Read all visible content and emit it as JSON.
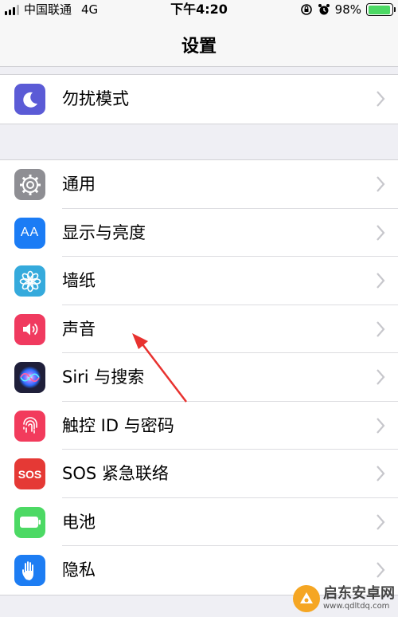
{
  "status_bar": {
    "carrier": "中国联通",
    "network": "4G",
    "time": "下午4:20",
    "battery": "98%",
    "battery_level": 0.98
  },
  "nav": {
    "title": "设置"
  },
  "groups": [
    {
      "items": [
        {
          "label": "勿扰模式",
          "icon": "moon-icon",
          "color": "#5b5bd6"
        }
      ]
    },
    {
      "items": [
        {
          "label": "通用",
          "icon": "gear-icon",
          "color": "#8e8e93"
        },
        {
          "label": "显示与亮度",
          "icon": "text-size-icon",
          "color": "#1b7cf5"
        },
        {
          "label": "墙纸",
          "icon": "flower-icon",
          "color": "#35aadc"
        },
        {
          "label": "声音",
          "icon": "speaker-icon",
          "color": "#f03a5f"
        },
        {
          "label": "Siri 与搜索",
          "icon": "siri-icon",
          "color": "#1f1f3a"
        },
        {
          "label": "触控 ID 与密码",
          "icon": "fingerprint-icon",
          "color": "#f23b5c"
        },
        {
          "label": "SOS 紧急联络",
          "icon": "sos-icon",
          "color": "#e53935"
        },
        {
          "label": "电池",
          "icon": "battery-icon",
          "color": "#4cd964"
        },
        {
          "label": "隐私",
          "icon": "hand-icon",
          "color": "#1d7df3"
        }
      ]
    }
  ],
  "icon_text": {
    "text_size": "AA",
    "sos": "SOS"
  },
  "watermark": {
    "name": "启东安卓网",
    "url": "www.qdltdq.com"
  }
}
